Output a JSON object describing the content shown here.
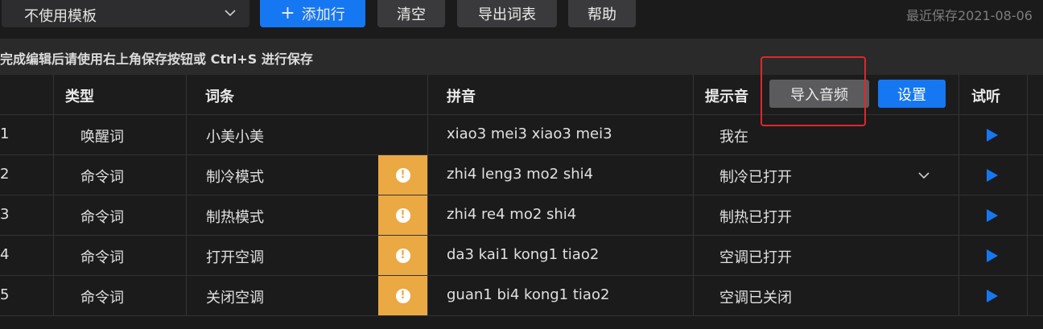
{
  "toolbar": {
    "template_select": "不使用模板",
    "add_row": "添加行",
    "add_icon": "+",
    "clear": "清空",
    "export": "导出词表",
    "help": "帮助",
    "last_saved": "最近保存2021-08-06"
  },
  "hint": "完成编辑后请使用右上角保存按钮或 Ctrl+S 进行保存",
  "columns": {
    "type": "类型",
    "entry": "词条",
    "pinyin": "拼音",
    "prompt": "提示音",
    "listen": "试听"
  },
  "header_buttons": {
    "import_audio": "导入音频",
    "settings": "设置"
  },
  "rows": [
    {
      "index": "1",
      "type": "唤醒词",
      "entry": "小美小美",
      "warning": false,
      "pinyin": "xiao3 mei3 xiao3 mei3",
      "prompt": "我在",
      "dropdown": false
    },
    {
      "index": "2",
      "type": "命令词",
      "entry": "制冷模式",
      "warning": true,
      "pinyin": "zhi4 leng3 mo2 shi4",
      "prompt": "制冷已打开",
      "dropdown": true
    },
    {
      "index": "3",
      "type": "命令词",
      "entry": "制热模式",
      "warning": true,
      "pinyin": "zhi4 re4 mo2 shi4",
      "prompt": "制热已打开",
      "dropdown": false
    },
    {
      "index": "4",
      "type": "命令词",
      "entry": "打开空调",
      "warning": true,
      "pinyin": "da3 kai1 kong1 tiao2",
      "prompt": "空调已打开",
      "dropdown": false
    },
    {
      "index": "5",
      "type": "命令词",
      "entry": "关闭空调",
      "warning": true,
      "pinyin": "guan1 bi4 kong1 tiao2",
      "prompt": "空调已关闭",
      "dropdown": false
    }
  ],
  "warning_glyph": "!",
  "colors": {
    "primary": "#1677f2",
    "warning": "#eba943",
    "highlight": "#e0262b"
  }
}
